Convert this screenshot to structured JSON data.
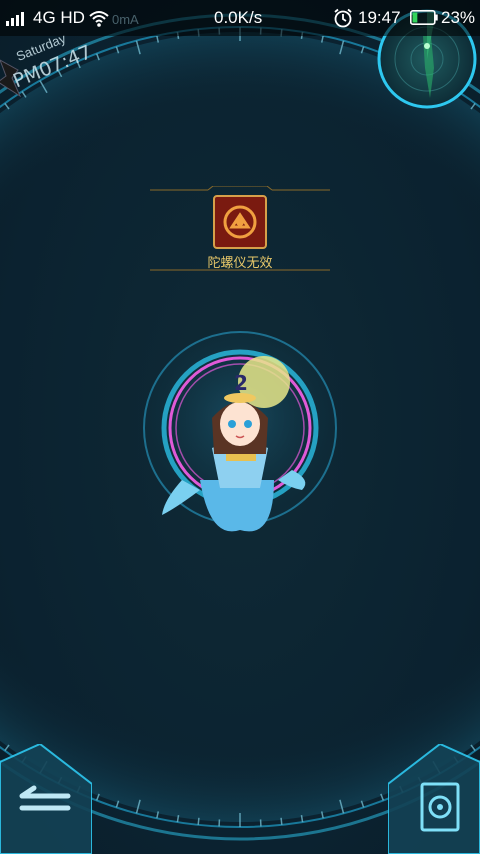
{
  "status_bar": {
    "network": "4G HD",
    "speed": "0.0K/s",
    "time": "19:47",
    "battery_percent": "23%",
    "battery_level": 0.23,
    "overlay_text": "0mA"
  },
  "date_widget": {
    "day": "Saturday",
    "time": "PM07:47"
  },
  "effect": {
    "label": "陀螺仪无效"
  },
  "colors": {
    "background": "#0b2230",
    "accent_cyan": "#2ec8f0",
    "accent_gold": "#c9a24a",
    "pink_ring": "#e05ad8"
  },
  "icons": {
    "signal": "signal-bars-icon",
    "wifi": "wifi-icon",
    "alarm": "alarm-clock-icon",
    "battery": "battery-icon",
    "back": "back-arrow-icon",
    "map": "map-icon",
    "gyro": "gyroscope-icon"
  }
}
